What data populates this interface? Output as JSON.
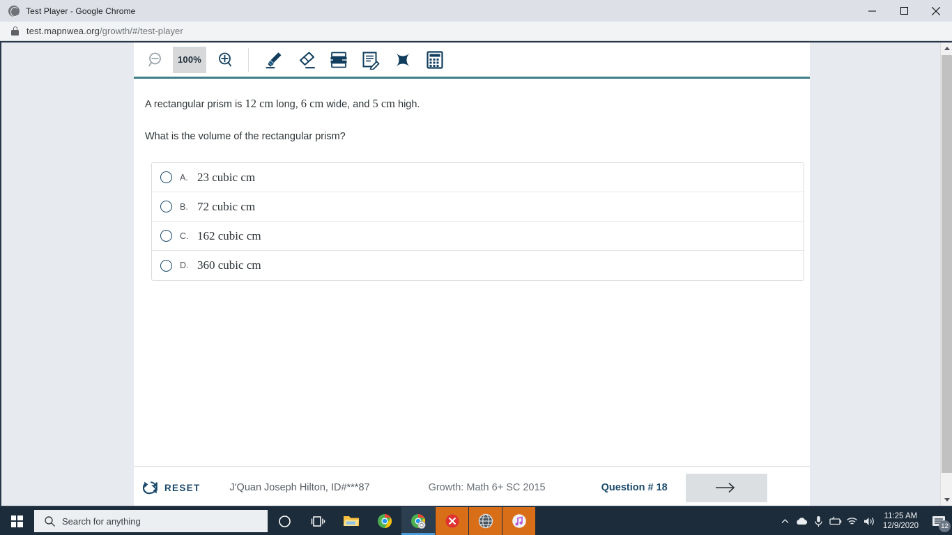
{
  "browser": {
    "window_title": "Test Player - Google Chrome",
    "url_prefix": "test.mapnwea.org",
    "url_suffix": "/growth/#/test-player",
    "minimize_label": "Minimize",
    "maximize_label": "Maximize",
    "close_label": "Close"
  },
  "toolbar": {
    "zoom_out_label": "Zoom out",
    "zoom_level": "100%",
    "zoom_in_label": "Zoom in",
    "tools": [
      {
        "name": "highlighter",
        "label": "Highlighter"
      },
      {
        "name": "eraser",
        "label": "Eraser"
      },
      {
        "name": "line-reader",
        "label": "Line Reader"
      },
      {
        "name": "notepad",
        "label": "Notepad"
      },
      {
        "name": "cross-out",
        "label": "Answer Eliminator"
      },
      {
        "name": "calculator",
        "label": "Calculator"
      }
    ]
  },
  "question": {
    "stem_line1_prefix": "A rectangular prism is ",
    "stem_line1_n1": "12 cm",
    "stem_line1_mid1": " long, ",
    "stem_line1_n2": "6 cm",
    "stem_line1_mid2": " wide, and ",
    "stem_line1_n3": "5 cm",
    "stem_line1_suffix": " high.",
    "stem_line2": "What is the volume of the rectangular prism?",
    "options": [
      {
        "letter": "A.",
        "text": "23 cubic cm",
        "selected": false
      },
      {
        "letter": "B.",
        "text": "72 cubic cm",
        "selected": false
      },
      {
        "letter": "C.",
        "text": "162 cubic cm",
        "selected": false
      },
      {
        "letter": "D.",
        "text": "360 cubic cm",
        "selected": false
      }
    ]
  },
  "footer": {
    "reset_label": "RESET",
    "student": "J'Quan Joseph Hilton, ID#***87",
    "test_name": "Growth: Math 6+ SC 2015",
    "question_number": "Question # 18",
    "next_label": "Next"
  },
  "taskbar": {
    "start_label": "Start",
    "search_placeholder": "Search for anything",
    "apps": [
      {
        "name": "cortana",
        "label": "Cortana"
      },
      {
        "name": "task-view",
        "label": "Task View"
      },
      {
        "name": "file-explorer",
        "label": "File Explorer"
      },
      {
        "name": "chrome",
        "label": "Google Chrome"
      },
      {
        "name": "chrome-active",
        "label": "Google Chrome - Test Player"
      },
      {
        "name": "close-app",
        "label": "Application"
      },
      {
        "name": "globe-app",
        "label": "Browser"
      },
      {
        "name": "itunes",
        "label": "iTunes"
      }
    ],
    "tray": [
      {
        "name": "show-hidden-icons",
        "label": "Show hidden icons"
      },
      {
        "name": "onedrive",
        "label": "OneDrive"
      },
      {
        "name": "microphone",
        "label": "Microphone"
      },
      {
        "name": "battery",
        "label": "Battery"
      },
      {
        "name": "wifi",
        "label": "Network"
      },
      {
        "name": "volume",
        "label": "Volume"
      }
    ],
    "time": "11:25 AM",
    "date": "12/9/2020",
    "notification_count": "12"
  },
  "colors": {
    "accent_teal": "#3e7e86",
    "navy": "#103d5d",
    "page_bg": "#e7ebef",
    "taskbar": "#1d2c3a"
  }
}
